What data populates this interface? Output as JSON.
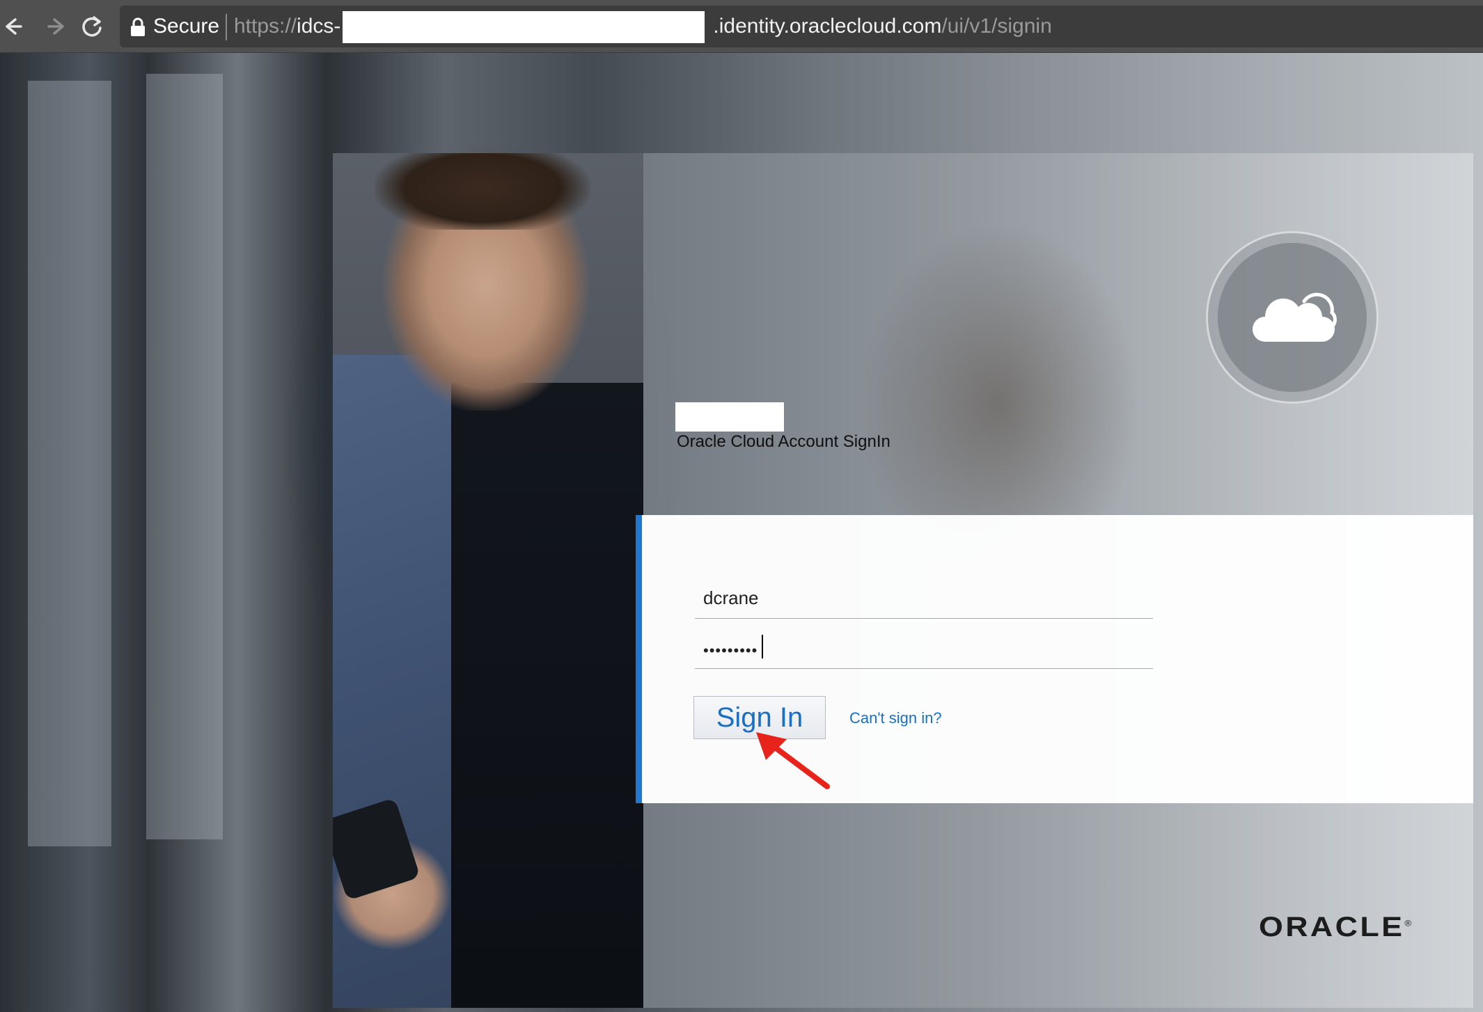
{
  "browser": {
    "secure_label": "Secure",
    "url_scheme": "https://",
    "url_prefix": "idcs-",
    "url_host": ".identity.oraclecloud.com",
    "url_path": "/ui/v1/signin"
  },
  "signin": {
    "title": "Oracle Cloud Account SignIn",
    "username_value": "dcrane",
    "password_dots": "•••••••••",
    "sign_in_label": "Sign In",
    "cant_sign_in_label": "Can't sign in?"
  },
  "branding": {
    "logo_text": "ORACLE",
    "logo_mark": "®",
    "accent_color": "#1f77d0",
    "link_color": "#1a6fc0"
  },
  "icons": {
    "back": "arrow-left-icon",
    "forward": "arrow-right-icon",
    "reload": "reload-icon",
    "lock": "lock-icon",
    "cloud": "cloud-icon",
    "annotation": "red-arrow-icon"
  }
}
